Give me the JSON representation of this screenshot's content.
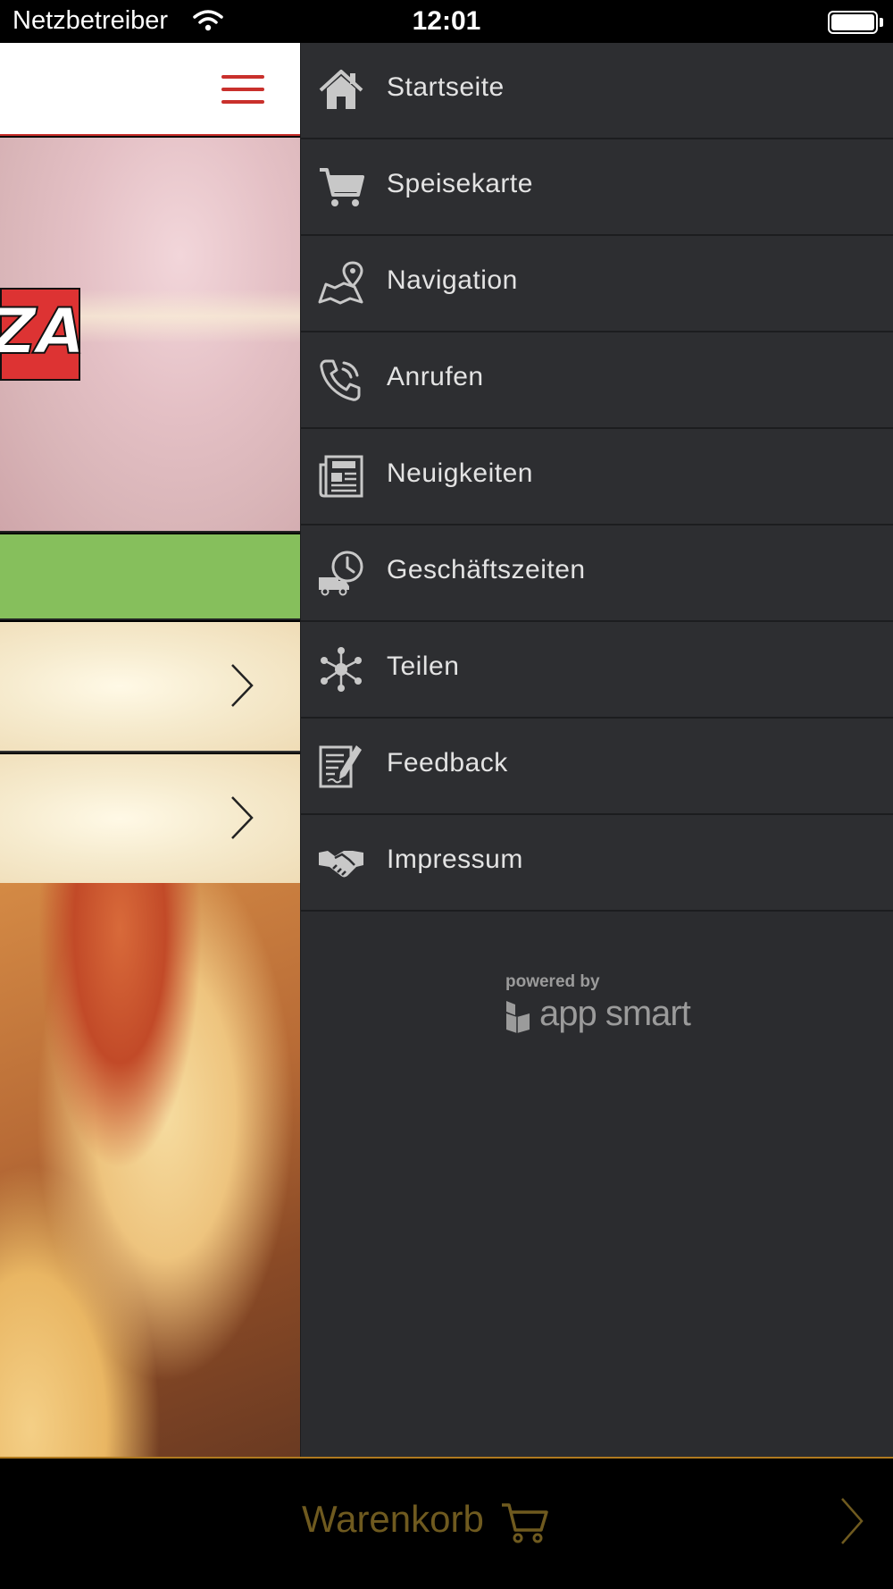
{
  "status_bar": {
    "carrier": "Netzbetreiber",
    "time": "12:01"
  },
  "menu": {
    "items": [
      {
        "label": "Startseite",
        "icon": "home-icon"
      },
      {
        "label": "Speisekarte",
        "icon": "cart-icon"
      },
      {
        "label": "Navigation",
        "icon": "map-pin-icon"
      },
      {
        "label": "Anrufen",
        "icon": "phone-icon"
      },
      {
        "label": "Neuigkeiten",
        "icon": "newspaper-icon"
      },
      {
        "label": "Geschäftszeiten",
        "icon": "delivery-clock-icon"
      },
      {
        "label": "Teilen",
        "icon": "share-network-icon"
      },
      {
        "label": "Feedback",
        "icon": "feedback-icon"
      },
      {
        "label": "Impressum",
        "icon": "handshake-icon"
      }
    ],
    "powered_by": "powered by",
    "brand": "app smart"
  },
  "cart": {
    "label": "Warenkorb"
  },
  "colors": {
    "accent_red": "#c9302c",
    "menu_bg": "#2b2c2f",
    "green_bar": "#86bf5c",
    "cart_text": "#6f5a1f",
    "cart_border": "#b07a1f"
  }
}
